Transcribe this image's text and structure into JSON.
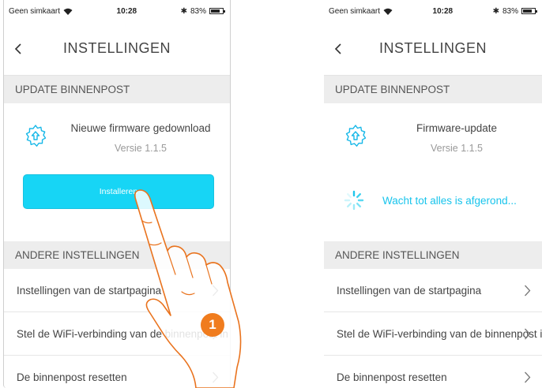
{
  "colors": {
    "accent": "#17d5f5",
    "wait_text": "#18c4ec",
    "section_bg": "#ededed",
    "badge": "#f07c1e"
  },
  "left_screen": {
    "status": {
      "carrier": "Geen simkaart",
      "time": "10:28",
      "battery": "83%",
      "battery_level": 0.83
    },
    "nav": {
      "title": "INSTELLINGEN",
      "back_icon": "chevron-left-icon"
    },
    "update_section": {
      "header": "UPDATE BINNENPOST",
      "icon": "gear-upload-icon",
      "title": "Nieuwe firmware gedownload",
      "version": "Versie 1.1.5",
      "install_label": "Installeren"
    },
    "other_section": {
      "header": "ANDERE INSTELLINGEN",
      "items": [
        {
          "label": "Instellingen van de startpagina"
        },
        {
          "label": "Stel de WiFi-verbinding van de binnenpost in"
        },
        {
          "label": "De binnenpost resetten"
        }
      ]
    }
  },
  "right_screen": {
    "status": {
      "carrier": "Geen simkaart",
      "time": "10:28",
      "battery": "83%",
      "battery_level": 0.83
    },
    "nav": {
      "title": "INSTELLINGEN",
      "back_icon": "chevron-left-icon"
    },
    "update_section": {
      "header": "UPDATE BINNENPOST",
      "icon": "gear-upload-icon",
      "title": "Firmware-update",
      "version": "Versie 1.1.5",
      "wait_text": "Wacht tot alles is afgerond..."
    },
    "other_section": {
      "header": "ANDERE INSTELLINGEN",
      "items": [
        {
          "label": "Instellingen van de startpagina"
        },
        {
          "label": "Stel de WiFi-verbinding van de binnenpost in"
        },
        {
          "label": "De binnenpost resetten"
        }
      ]
    }
  },
  "annotation": {
    "step_number": "1",
    "icon": "pointing-hand-icon"
  }
}
